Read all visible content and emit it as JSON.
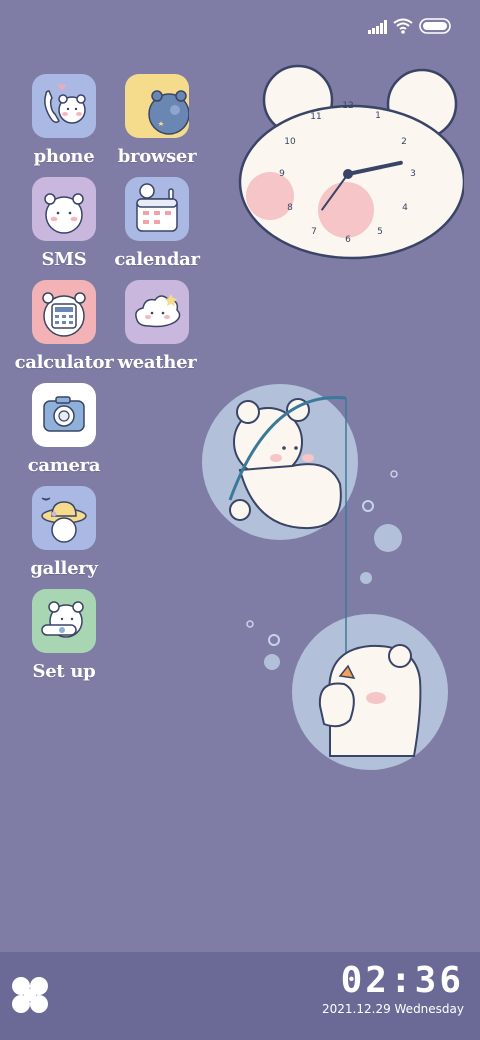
{
  "status": {
    "signal_icon": "signal-bars-icon",
    "wifi_icon": "wifi-icon",
    "battery_icon": "battery-icon"
  },
  "apps": [
    {
      "label": "phone",
      "icon": "phone-bear-icon",
      "bg": "#a9b9e4"
    },
    {
      "label": "browser",
      "icon": "browser-bear-icon",
      "bg": "#f5dc8c"
    },
    {
      "label": "SMS",
      "icon": "sms-bear-icon",
      "bg": "#c9b7de"
    },
    {
      "label": "calendar",
      "icon": "calendar-bear-icon",
      "bg": "#a9b9e4"
    },
    {
      "label": "calculator",
      "icon": "calculator-bear-icon",
      "bg": "#f3b3b6"
    },
    {
      "label": "weather",
      "icon": "weather-cloud-icon",
      "bg": "#c9b7de"
    },
    {
      "label": "camera",
      "icon": "camera-icon",
      "bg": "#ffffff"
    },
    {
      "label": "gallery",
      "icon": "gallery-bear-icon",
      "bg": "#a9b9e4"
    },
    {
      "label": "Set up",
      "icon": "settings-bear-icon",
      "bg": "#a8d6b3"
    }
  ],
  "analog_clock": {
    "numbers": [
      "12",
      "1",
      "2",
      "3",
      "4",
      "5",
      "6",
      "7",
      "8",
      "9",
      "10",
      "11"
    ],
    "hour": 2,
    "minute": 36
  },
  "dock": {
    "menu_icon": "four-petal-menu-icon",
    "time": "02:36",
    "date": "2021.12.29 Wednesday"
  }
}
